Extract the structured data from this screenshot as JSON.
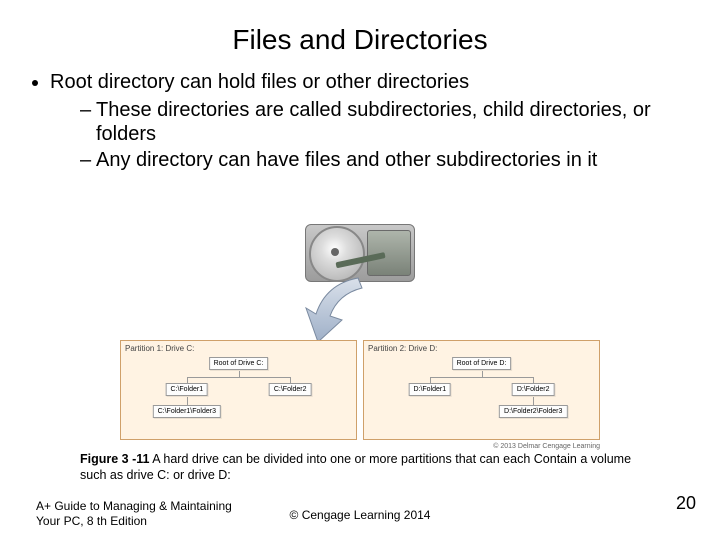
{
  "title": "Files and Directories",
  "bullets": {
    "root": "Root directory can hold files or other directories",
    "sub1": "These directories are called subdirectories, child directories, or folders",
    "sub2": "Any directory can have files and other subdirectories in it"
  },
  "diagram": {
    "credit": "© 2013 Delmar Cengage Learning",
    "partitions": [
      {
        "label": "Partition 1: Drive C:",
        "root": "Root of Drive C:",
        "c1": "C:\\Folder1",
        "c2": "C:\\Folder2",
        "leaf": "C:\\Folder1\\Folder3"
      },
      {
        "label": "Partition 2: Drive D:",
        "root": "Root of Drive D:",
        "c1": "D:\\Folder1",
        "c2": "D:\\Folder2",
        "leaf": "D:\\Folder2\\Folder3"
      }
    ]
  },
  "caption_label": "Figure 3 -11",
  "caption_text": "A hard drive can be divided into one or more partitions that can each Contain a volume such as drive C: or drive D:",
  "footer": {
    "left1": "A+ Guide to Managing & Maintaining",
    "left2": "Your PC, 8 th Edition",
    "center": "© Cengage Learning 2014",
    "page": "20"
  }
}
